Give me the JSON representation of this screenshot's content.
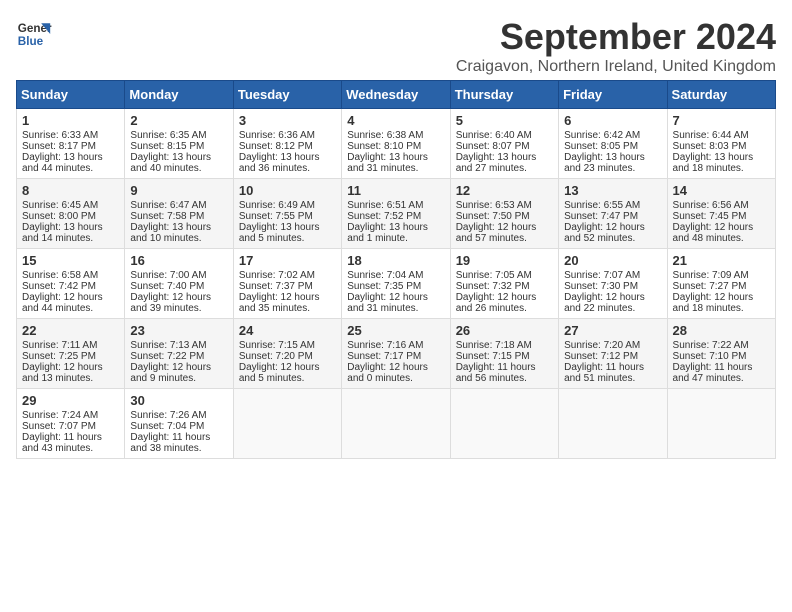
{
  "header": {
    "logo_line1": "General",
    "logo_line2": "Blue",
    "month_title": "September 2024",
    "location": "Craigavon, Northern Ireland, United Kingdom"
  },
  "days_of_week": [
    "Sunday",
    "Monday",
    "Tuesday",
    "Wednesday",
    "Thursday",
    "Friday",
    "Saturday"
  ],
  "weeks": [
    [
      {
        "day": "1",
        "lines": [
          "Sunrise: 6:33 AM",
          "Sunset: 8:17 PM",
          "Daylight: 13 hours",
          "and 44 minutes."
        ]
      },
      {
        "day": "2",
        "lines": [
          "Sunrise: 6:35 AM",
          "Sunset: 8:15 PM",
          "Daylight: 13 hours",
          "and 40 minutes."
        ]
      },
      {
        "day": "3",
        "lines": [
          "Sunrise: 6:36 AM",
          "Sunset: 8:12 PM",
          "Daylight: 13 hours",
          "and 36 minutes."
        ]
      },
      {
        "day": "4",
        "lines": [
          "Sunrise: 6:38 AM",
          "Sunset: 8:10 PM",
          "Daylight: 13 hours",
          "and 31 minutes."
        ]
      },
      {
        "day": "5",
        "lines": [
          "Sunrise: 6:40 AM",
          "Sunset: 8:07 PM",
          "Daylight: 13 hours",
          "and 27 minutes."
        ]
      },
      {
        "day": "6",
        "lines": [
          "Sunrise: 6:42 AM",
          "Sunset: 8:05 PM",
          "Daylight: 13 hours",
          "and 23 minutes."
        ]
      },
      {
        "day": "7",
        "lines": [
          "Sunrise: 6:44 AM",
          "Sunset: 8:03 PM",
          "Daylight: 13 hours",
          "and 18 minutes."
        ]
      }
    ],
    [
      {
        "day": "8",
        "lines": [
          "Sunrise: 6:45 AM",
          "Sunset: 8:00 PM",
          "Daylight: 13 hours",
          "and 14 minutes."
        ]
      },
      {
        "day": "9",
        "lines": [
          "Sunrise: 6:47 AM",
          "Sunset: 7:58 PM",
          "Daylight: 13 hours",
          "and 10 minutes."
        ]
      },
      {
        "day": "10",
        "lines": [
          "Sunrise: 6:49 AM",
          "Sunset: 7:55 PM",
          "Daylight: 13 hours",
          "and 5 minutes."
        ]
      },
      {
        "day": "11",
        "lines": [
          "Sunrise: 6:51 AM",
          "Sunset: 7:52 PM",
          "Daylight: 13 hours",
          "and 1 minute."
        ]
      },
      {
        "day": "12",
        "lines": [
          "Sunrise: 6:53 AM",
          "Sunset: 7:50 PM",
          "Daylight: 12 hours",
          "and 57 minutes."
        ]
      },
      {
        "day": "13",
        "lines": [
          "Sunrise: 6:55 AM",
          "Sunset: 7:47 PM",
          "Daylight: 12 hours",
          "and 52 minutes."
        ]
      },
      {
        "day": "14",
        "lines": [
          "Sunrise: 6:56 AM",
          "Sunset: 7:45 PM",
          "Daylight: 12 hours",
          "and 48 minutes."
        ]
      }
    ],
    [
      {
        "day": "15",
        "lines": [
          "Sunrise: 6:58 AM",
          "Sunset: 7:42 PM",
          "Daylight: 12 hours",
          "and 44 minutes."
        ]
      },
      {
        "day": "16",
        "lines": [
          "Sunrise: 7:00 AM",
          "Sunset: 7:40 PM",
          "Daylight: 12 hours",
          "and 39 minutes."
        ]
      },
      {
        "day": "17",
        "lines": [
          "Sunrise: 7:02 AM",
          "Sunset: 7:37 PM",
          "Daylight: 12 hours",
          "and 35 minutes."
        ]
      },
      {
        "day": "18",
        "lines": [
          "Sunrise: 7:04 AM",
          "Sunset: 7:35 PM",
          "Daylight: 12 hours",
          "and 31 minutes."
        ]
      },
      {
        "day": "19",
        "lines": [
          "Sunrise: 7:05 AM",
          "Sunset: 7:32 PM",
          "Daylight: 12 hours",
          "and 26 minutes."
        ]
      },
      {
        "day": "20",
        "lines": [
          "Sunrise: 7:07 AM",
          "Sunset: 7:30 PM",
          "Daylight: 12 hours",
          "and 22 minutes."
        ]
      },
      {
        "day": "21",
        "lines": [
          "Sunrise: 7:09 AM",
          "Sunset: 7:27 PM",
          "Daylight: 12 hours",
          "and 18 minutes."
        ]
      }
    ],
    [
      {
        "day": "22",
        "lines": [
          "Sunrise: 7:11 AM",
          "Sunset: 7:25 PM",
          "Daylight: 12 hours",
          "and 13 minutes."
        ]
      },
      {
        "day": "23",
        "lines": [
          "Sunrise: 7:13 AM",
          "Sunset: 7:22 PM",
          "Daylight: 12 hours",
          "and 9 minutes."
        ]
      },
      {
        "day": "24",
        "lines": [
          "Sunrise: 7:15 AM",
          "Sunset: 7:20 PM",
          "Daylight: 12 hours",
          "and 5 minutes."
        ]
      },
      {
        "day": "25",
        "lines": [
          "Sunrise: 7:16 AM",
          "Sunset: 7:17 PM",
          "Daylight: 12 hours",
          "and 0 minutes."
        ]
      },
      {
        "day": "26",
        "lines": [
          "Sunrise: 7:18 AM",
          "Sunset: 7:15 PM",
          "Daylight: 11 hours",
          "and 56 minutes."
        ]
      },
      {
        "day": "27",
        "lines": [
          "Sunrise: 7:20 AM",
          "Sunset: 7:12 PM",
          "Daylight: 11 hours",
          "and 51 minutes."
        ]
      },
      {
        "day": "28",
        "lines": [
          "Sunrise: 7:22 AM",
          "Sunset: 7:10 PM",
          "Daylight: 11 hours",
          "and 47 minutes."
        ]
      }
    ],
    [
      {
        "day": "29",
        "lines": [
          "Sunrise: 7:24 AM",
          "Sunset: 7:07 PM",
          "Daylight: 11 hours",
          "and 43 minutes."
        ]
      },
      {
        "day": "30",
        "lines": [
          "Sunrise: 7:26 AM",
          "Sunset: 7:04 PM",
          "Daylight: 11 hours",
          "and 38 minutes."
        ]
      },
      {
        "day": "",
        "lines": []
      },
      {
        "day": "",
        "lines": []
      },
      {
        "day": "",
        "lines": []
      },
      {
        "day": "",
        "lines": []
      },
      {
        "day": "",
        "lines": []
      }
    ]
  ]
}
